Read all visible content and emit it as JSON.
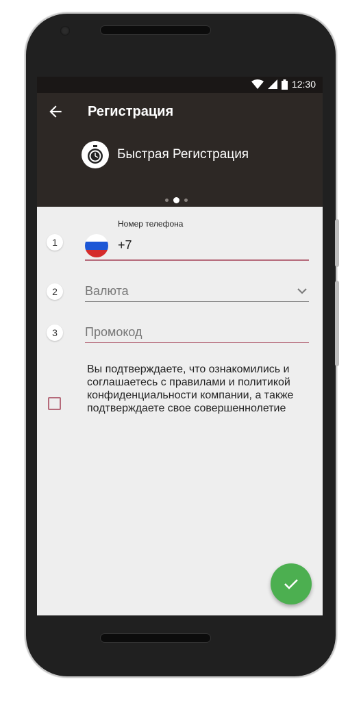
{
  "status_bar": {
    "time": "12:30",
    "icons": [
      "wifi-icon",
      "signal-icon",
      "battery-icon"
    ]
  },
  "app_bar": {
    "title": "Регистрация",
    "back_icon": "arrow-left-icon",
    "subtitle_icon": "stopwatch-icon",
    "subtitle": "Быстрая Регистрация",
    "pager": {
      "count": 3,
      "active": 1
    }
  },
  "form": {
    "phone": {
      "step": "1",
      "label": "Номер телефона",
      "value": "+7",
      "flag": "russia-flag"
    },
    "currency": {
      "step": "2",
      "placeholder": "Валюта"
    },
    "promo": {
      "step": "3",
      "placeholder": "Промокод"
    },
    "consent": {
      "checked": false,
      "text": "Вы подтверждаете, что ознакомились и соглашаетесь с правилами и политикой конфиденциальности компании, а также подтверждаете свое совершеннолетие"
    }
  },
  "fab": {
    "icon": "check-icon"
  },
  "colors": {
    "appbar": "#2d2825",
    "statusbar": "#1a1716",
    "accent_line": "#b56a7a",
    "fab": "#4caf50",
    "screen_bg": "#eeeeee"
  }
}
